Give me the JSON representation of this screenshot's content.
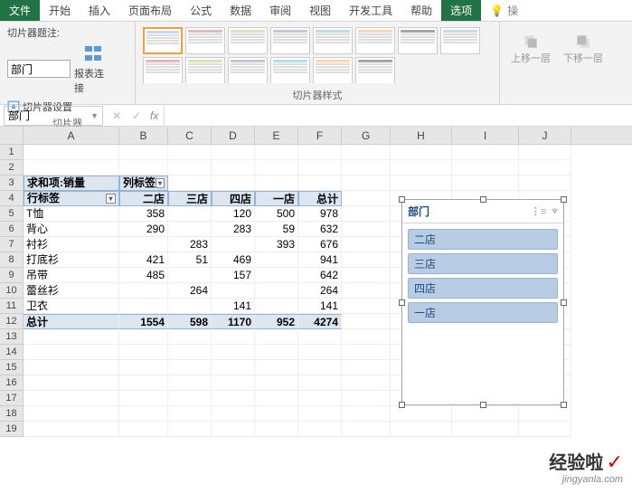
{
  "tabs": {
    "file": "文件",
    "home": "开始",
    "insert": "插入",
    "page_layout": "页面布局",
    "formulas": "公式",
    "data": "数据",
    "review": "审阅",
    "view": "视图",
    "developer": "开发工具",
    "help": "帮助",
    "options": "选项",
    "tell_me": "操"
  },
  "ribbon": {
    "slicer_caption_label": "切片器题注:",
    "slicer_caption_value": "部门",
    "slicer_settings": "切片器设置",
    "report_connections": "报表连接",
    "group_slicer": "切片器",
    "group_styles": "切片器样式",
    "bring_forward": "上移一层",
    "send_backward": "下移一层"
  },
  "style_colors": [
    "#c6d9f0",
    "#e6b8b7",
    "#d8e4bc",
    "#ccc0da",
    "#b7dee8",
    "#fcd5b4",
    "#a5a5a5"
  ],
  "name_box": "部门",
  "columns": [
    "A",
    "B",
    "C",
    "D",
    "E",
    "F",
    "G",
    "H",
    "I",
    "J"
  ],
  "pivot": {
    "header1": "求和项:销量",
    "header2": "列标签",
    "row_label": "行标签",
    "col_headers": [
      "二店",
      "三店",
      "四店",
      "一店",
      "总计"
    ],
    "rows": [
      {
        "label": "T恤",
        "vals": [
          "358",
          "",
          "120",
          "500",
          "978"
        ]
      },
      {
        "label": "背心",
        "vals": [
          "290",
          "",
          "283",
          "59",
          "632"
        ]
      },
      {
        "label": "衬衫",
        "vals": [
          "",
          "283",
          "",
          "393",
          "676"
        ]
      },
      {
        "label": "打底衫",
        "vals": [
          "421",
          "51",
          "469",
          "",
          "941"
        ]
      },
      {
        "label": "吊带",
        "vals": [
          "485",
          "",
          "157",
          "",
          "642"
        ]
      },
      {
        "label": "蕾丝衫",
        "vals": [
          "",
          "264",
          "",
          "",
          "264"
        ]
      },
      {
        "label": "卫衣",
        "vals": [
          "",
          "",
          "141",
          "",
          "141"
        ]
      }
    ],
    "total_label": "总计",
    "totals": [
      "1554",
      "598",
      "1170",
      "952",
      "4274"
    ]
  },
  "slicer": {
    "title": "部门",
    "items": [
      "二店",
      "三店",
      "四店",
      "一店"
    ]
  },
  "watermark": {
    "main": "经验啦",
    "check": "✓",
    "sub": "jingyanla.com"
  }
}
